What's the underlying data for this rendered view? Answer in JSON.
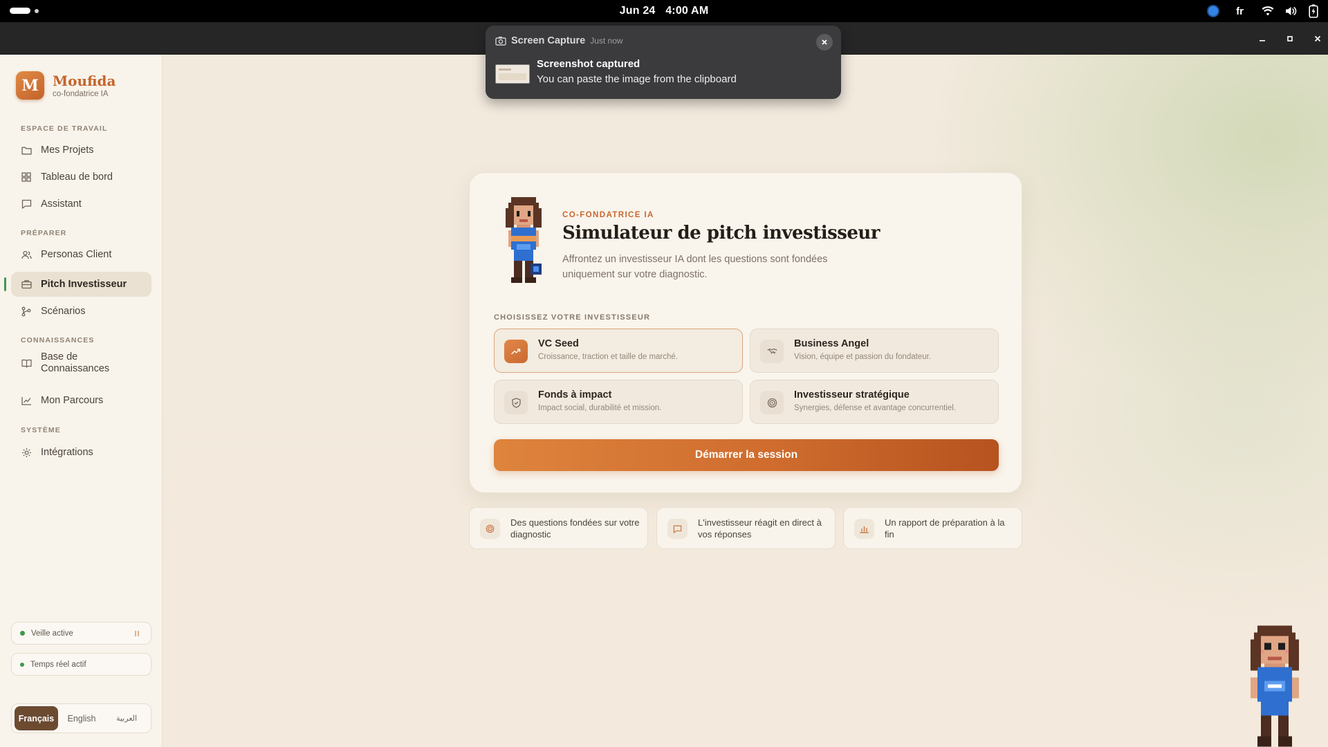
{
  "system_bar": {
    "date": "Jun 24",
    "time": "4:00 AM",
    "input_language": "fr",
    "icons": [
      "privacy-indicator",
      "wifi-icon",
      "volume-icon",
      "battery-icon"
    ]
  },
  "window": {
    "controls": [
      "minimize",
      "maximize",
      "close"
    ]
  },
  "notification": {
    "app": "Screen Capture",
    "time": "Just now",
    "title": "Screenshot captured",
    "body": "You can paste the image from the clipboard"
  },
  "sidebar": {
    "brand": {
      "logo_letter": "M",
      "name": "Moufida",
      "subtitle": "co-fondatrice IA"
    },
    "sections": [
      {
        "title": "ESPACE DE TRAVAIL",
        "items": [
          {
            "label": "Mes Projets",
            "icon": "folder-icon"
          },
          {
            "label": "Tableau de bord",
            "icon": "grid-icon"
          },
          {
            "label": "Assistant",
            "icon": "chat-icon"
          }
        ]
      },
      {
        "title": "PRÉPARER",
        "items": [
          {
            "label": "Personas Client",
            "icon": "users-icon"
          },
          {
            "label": "Pitch Investisseur",
            "icon": "briefcase-icon",
            "active": true
          },
          {
            "label": "Scénarios",
            "icon": "branch-icon"
          }
        ]
      },
      {
        "title": "CONNAISSANCES",
        "items": [
          {
            "label": "Base de Connaissances",
            "icon": "book-icon"
          },
          {
            "label": "Mon Parcours",
            "icon": "chart-line-icon"
          }
        ]
      },
      {
        "title": "SYSTÈME",
        "items": [
          {
            "label": "Intégrations",
            "icon": "gear-icon"
          }
        ]
      }
    ],
    "status": [
      {
        "label": "Veille active",
        "color": "#3c9a4c"
      },
      {
        "label": "Temps réel actif",
        "color": "#3c9a4c"
      }
    ],
    "languages": [
      {
        "label": "Français",
        "active": true
      },
      {
        "label": "English",
        "active": false
      },
      {
        "label": "العربية",
        "active": false
      }
    ]
  },
  "hero": {
    "eyebrow": "CO-FONDATRICE IA",
    "title": "Simulateur de pitch investisseur",
    "description": "Affrontez un investisseur IA dont les questions sont fondées uniquement sur votre diagnostic."
  },
  "investors": {
    "label": "CHOISISSEZ VOTRE INVESTISSEUR",
    "options": [
      {
        "title": "VC Seed",
        "description": "Croissance, traction et taille de marché.",
        "icon": "trending-up-icon",
        "selected": true
      },
      {
        "title": "Business Angel",
        "description": "Vision, équipe et passion du fondateur.",
        "icon": "handshake-icon",
        "selected": false
      },
      {
        "title": "Fonds à impact",
        "description": "Impact social, durabilité et mission.",
        "icon": "shield-icon",
        "selected": false
      },
      {
        "title": "Investisseur stratégique",
        "description": "Synergies, défense et avantage concurrentiel.",
        "icon": "target-icon",
        "selected": false
      }
    ]
  },
  "cta": {
    "label": "Démarrer la session"
  },
  "features": [
    {
      "text": "Des questions fondées sur votre diagnostic",
      "icon": "target-icon"
    },
    {
      "text": "L'investisseur réagit en direct à vos réponses",
      "icon": "chat-icon"
    },
    {
      "text": "Un rapport de préparation à la fin",
      "icon": "bar-chart-icon"
    }
  ],
  "colors": {
    "accent": "#c96a30",
    "active_indicator": "#3f9a4f",
    "background": "#f5ede2"
  }
}
